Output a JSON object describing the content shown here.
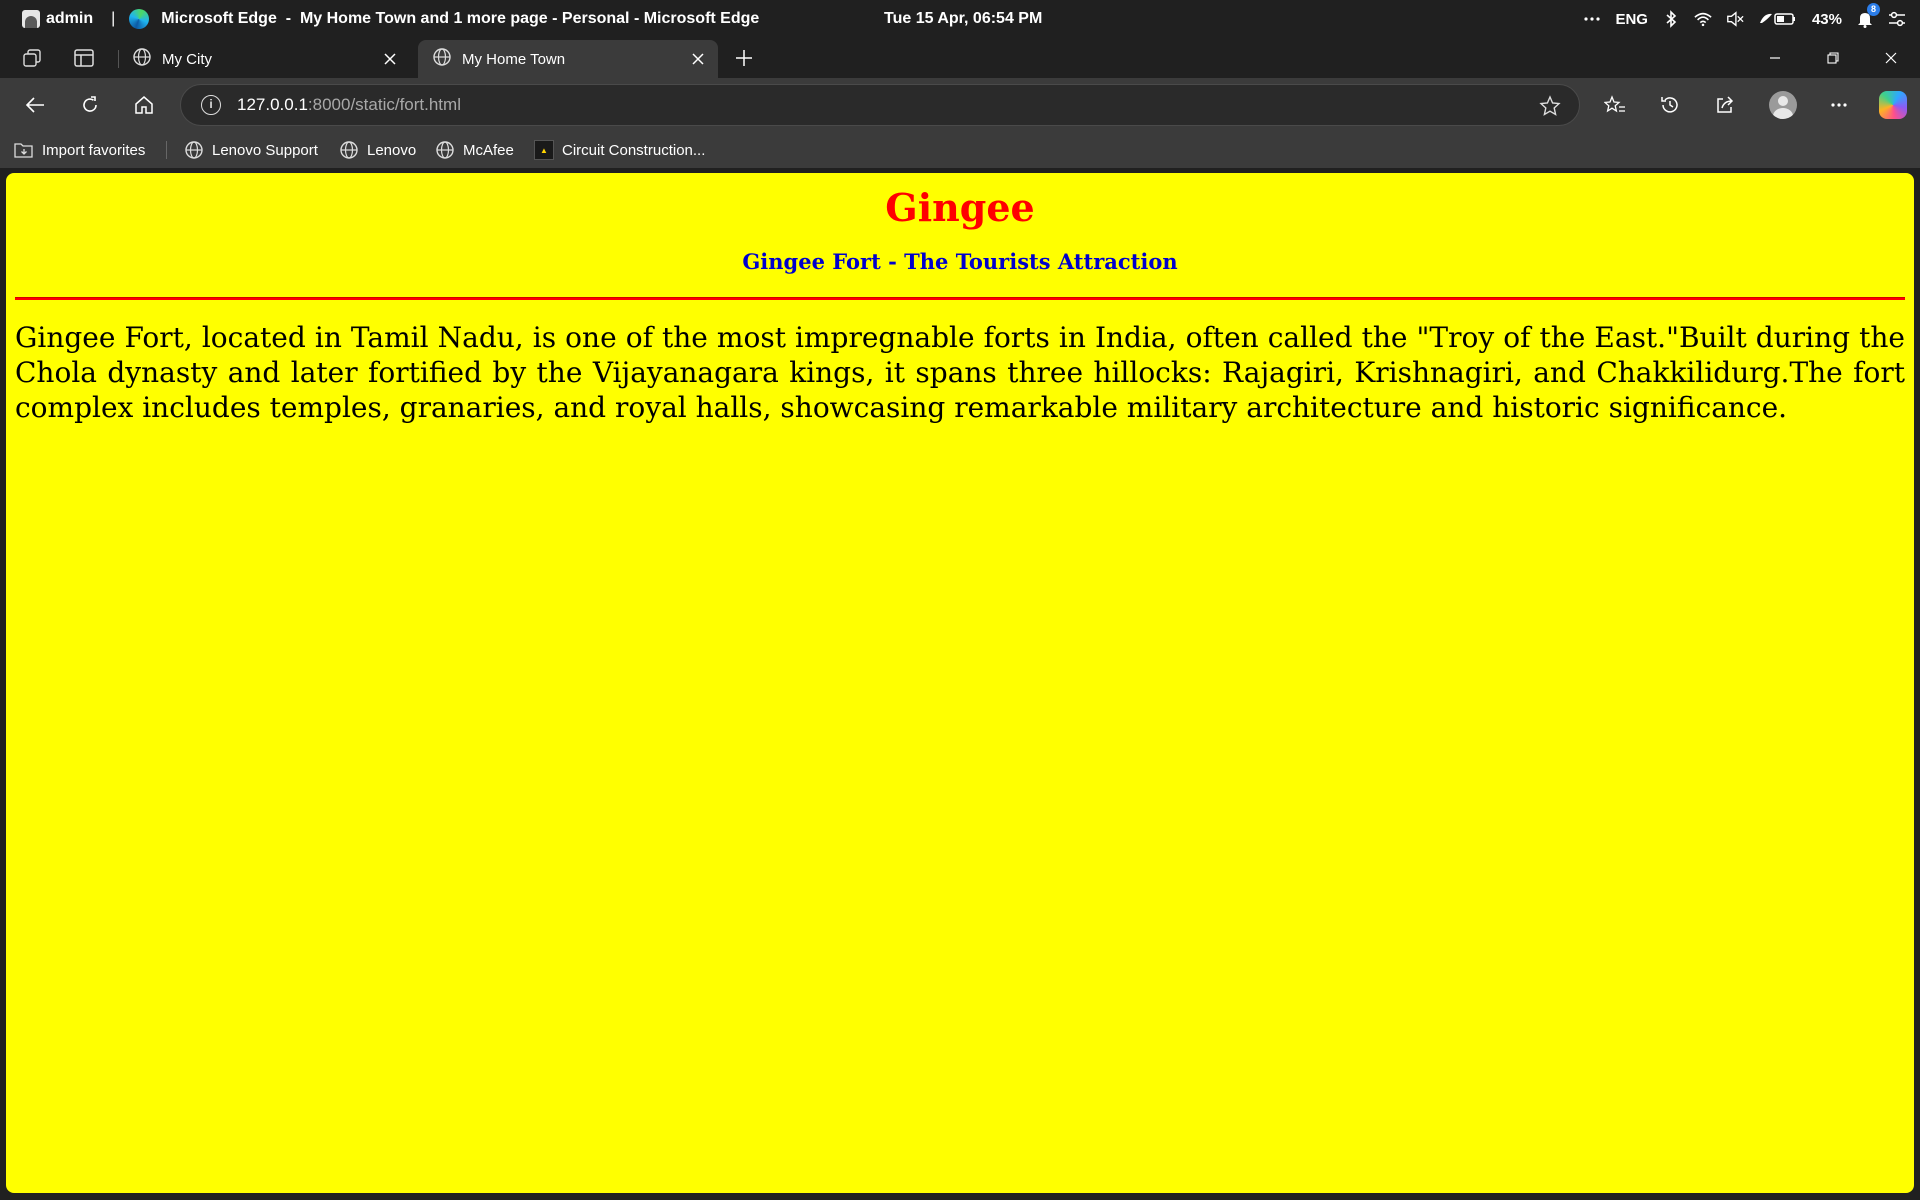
{
  "system_bar": {
    "user": "admin",
    "separator": "|",
    "window_title": "Microsoft Edge  -  My Home Town and 1 more page - Personal - Microsoft Edge",
    "datetime": "Tue 15 Apr, 06:54 PM",
    "language": "ENG",
    "battery": "43%",
    "notification_count": "8"
  },
  "tabs": [
    {
      "title": "My City",
      "active": false
    },
    {
      "title": "My Home Town",
      "active": true
    }
  ],
  "address_bar": {
    "url_host": "127.0.0.1",
    "url_path": ":8000/static/fort.html"
  },
  "favorites": [
    {
      "label": "Import favorites",
      "icon": "import-icon"
    },
    {
      "label": "Lenovo Support",
      "icon": "globe-icon"
    },
    {
      "label": "Lenovo",
      "icon": "globe-icon"
    },
    {
      "label": "McAfee",
      "icon": "globe-icon"
    },
    {
      "label": "Circuit Construction...",
      "icon": "phet-icon"
    }
  ],
  "page": {
    "title": "Gingee",
    "subtitle": "Gingee Fort - The Tourists Attraction",
    "body": "Gingee Fort, located in Tamil Nadu, is one of the most impregnable forts in India, often called the \"Troy of the East.\"Built during the Chola dynasty and later fortified by the Vijayanagara kings, it spans three hillocks: Rajagiri, Krishnagiri, and Chakkilidurg.The fort complex includes temples, granaries, and royal halls, showcasing remarkable military architecture and historic significance.",
    "colors": {
      "background": "#ffff00",
      "title": "#ff0000",
      "subtitle": "#0000cc",
      "rule": "#ff0000"
    }
  }
}
